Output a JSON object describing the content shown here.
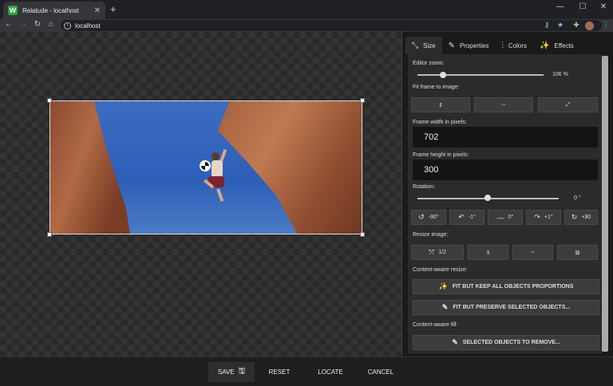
{
  "browser": {
    "tab_title": "Relatude - localhost",
    "favicon_letter": "W",
    "url": "localhost",
    "new_tab": "+",
    "close": "✕",
    "minimize": "—",
    "maximize": "☐",
    "win_close": "✕"
  },
  "panel": {
    "tabs": [
      {
        "label": "Size",
        "icon": "resize-icon"
      },
      {
        "label": "Properties",
        "icon": "pencil-icon"
      },
      {
        "label": "Colors",
        "icon": "sliders-icon"
      },
      {
        "label": "Effects",
        "icon": "magic-wand-icon"
      }
    ],
    "editor_zoom": {
      "label": "Editor zoom:",
      "value_text": "106 %",
      "value": 106
    },
    "fit_frame": {
      "label": "Fit frame to image:"
    },
    "frame_width": {
      "label": "Frame width in pixels:",
      "value": "702"
    },
    "frame_height": {
      "label": "Frame height in pixels:",
      "value": "300"
    },
    "rotation": {
      "label": "Rotation:",
      "value_text": "0 °",
      "value": 0
    },
    "rotate_buttons": [
      "-90°",
      "-1°",
      "0°",
      "+1°",
      "+90"
    ],
    "resize_image": {
      "label": "Resize image:",
      "half_label": "1/2"
    },
    "content_aware_resize": {
      "label": "Content-aware resize:",
      "fit_keep": "FIT BUT KEEP ALL OBJECTS PROPORTIONS",
      "fit_preserve": "FIT BUT PRESERVE SELECTED OBJECTS..."
    },
    "content_aware_fill": {
      "label": "Content-aware fill:",
      "remove": "SELECTED OBJECTS TO REMOVE..."
    }
  },
  "bottom": {
    "save": "SAVE",
    "reset": "RESET",
    "locate": "LOCATE",
    "cancel": "CANCEL"
  }
}
